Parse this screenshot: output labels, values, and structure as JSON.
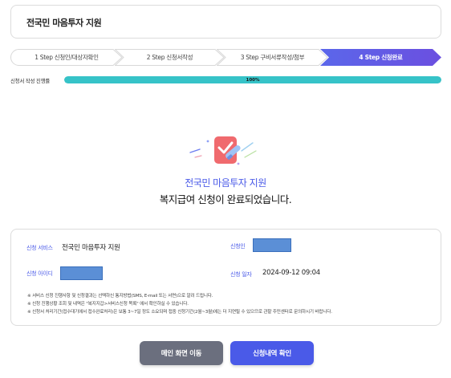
{
  "header": {
    "title": "전국민 마음투자 지원"
  },
  "steps": [
    {
      "label": "1 Step 신청인/대상자확인"
    },
    {
      "label": "2 Step 신청서작성"
    },
    {
      "label": "3 Step 구비서류작성/첨부"
    },
    {
      "label": "4 Step 신청완료"
    }
  ],
  "progress": {
    "label": "신청서 작성 진행률",
    "value_text": "100%",
    "value": 1.0
  },
  "hero": {
    "service_name": "전국민 마음투자 지원",
    "message": "복지급여 신청이 완료되었습니다.",
    "icon": "checklist-pen-icon"
  },
  "info": {
    "service_label": "신청 서비스",
    "service_value": "전국민 마음투자 지원",
    "applicant_label": "신청인",
    "id_label": "신청 아이디",
    "date_label": "신청 일자",
    "date_value": "2024-09-12 09:04",
    "notes": [
      "※ 서비스 신청 진행사항 및 신청결과는 선택하신 통지방법(SMS, E-mail 또는 서면)으로 알려 드립니다.",
      "※ 신청 진행상황 조회 및 내역은 \"복지지갑>서비스신청 목록\" 에서 확인하실 수 있습니다.",
      "※ 신청서 처리기간(접수대기에서 접수완료처리)은 보통 3~7일 정도 소요되며 접중 신청기간(2월~3월)에는 더 지연될 수 있으므로 관할 주민센터로 문의하시기 바랍니다."
    ]
  },
  "buttons": {
    "main": "메인 화면 이동",
    "history": "신청내역 확인"
  },
  "colors": {
    "accent": "#4a5ae8",
    "progress": "#36c3c8",
    "mask": "#5b8fd6",
    "secondary_button": "#6b6f7e"
  }
}
